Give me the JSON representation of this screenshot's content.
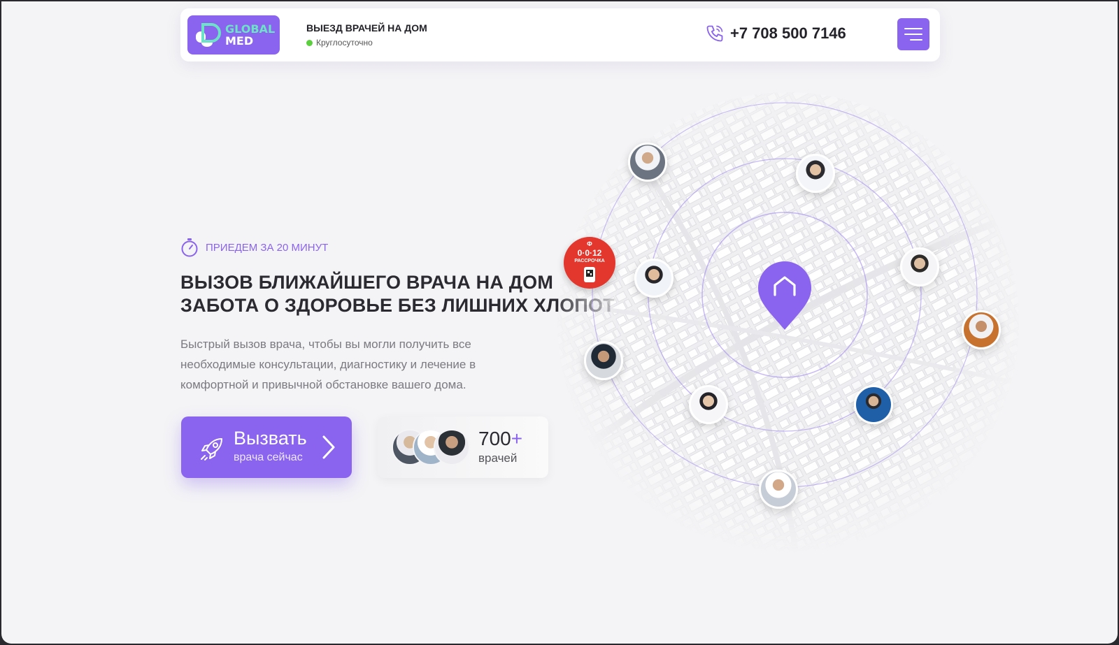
{
  "header": {
    "logo": {
      "line1": "GLOBAL",
      "line2": "MED"
    },
    "title": "ВЫЕЗД ВРАЧЕЙ НА ДОМ",
    "status": "Круглосуточно",
    "phone": "+7 708 500 7146"
  },
  "hero": {
    "kicker": "ПРИЕДЕМ ЗА 20 МИНУТ",
    "headline_line1": "ВЫЗОВ БЛИЖАЙШЕГО ВРАЧА НА ДОМ",
    "headline_line2": "ЗАБОТА О ЗДОРОВЬЕ БЕЗ ЛИШНИХ ХЛОПОТ",
    "description": "Быстрый вызов врача, чтобы вы могли получить все необходимые консультации, диагностику и лечение в комфортной и привычной обстановке вашего дома.",
    "cta_main": "Вызвать",
    "cta_sub": "врача сейчас",
    "doctors_count": "700",
    "doctors_plus": "+",
    "doctors_label": "врачей"
  },
  "promo_badge": {
    "brand": "Ф",
    "plan": "0·0·12",
    "label": "РАССРОЧКА"
  },
  "colors": {
    "accent": "#8a63ef",
    "logo_mint": "#6ce3c6",
    "status_green": "#5ccf3e",
    "badge_red": "#e3362d"
  },
  "icons": [
    "timer-icon",
    "phone-icon",
    "menu-icon",
    "rocket-icon",
    "chevron-right-icon",
    "home-pin-icon",
    "qr-phone-icon"
  ]
}
